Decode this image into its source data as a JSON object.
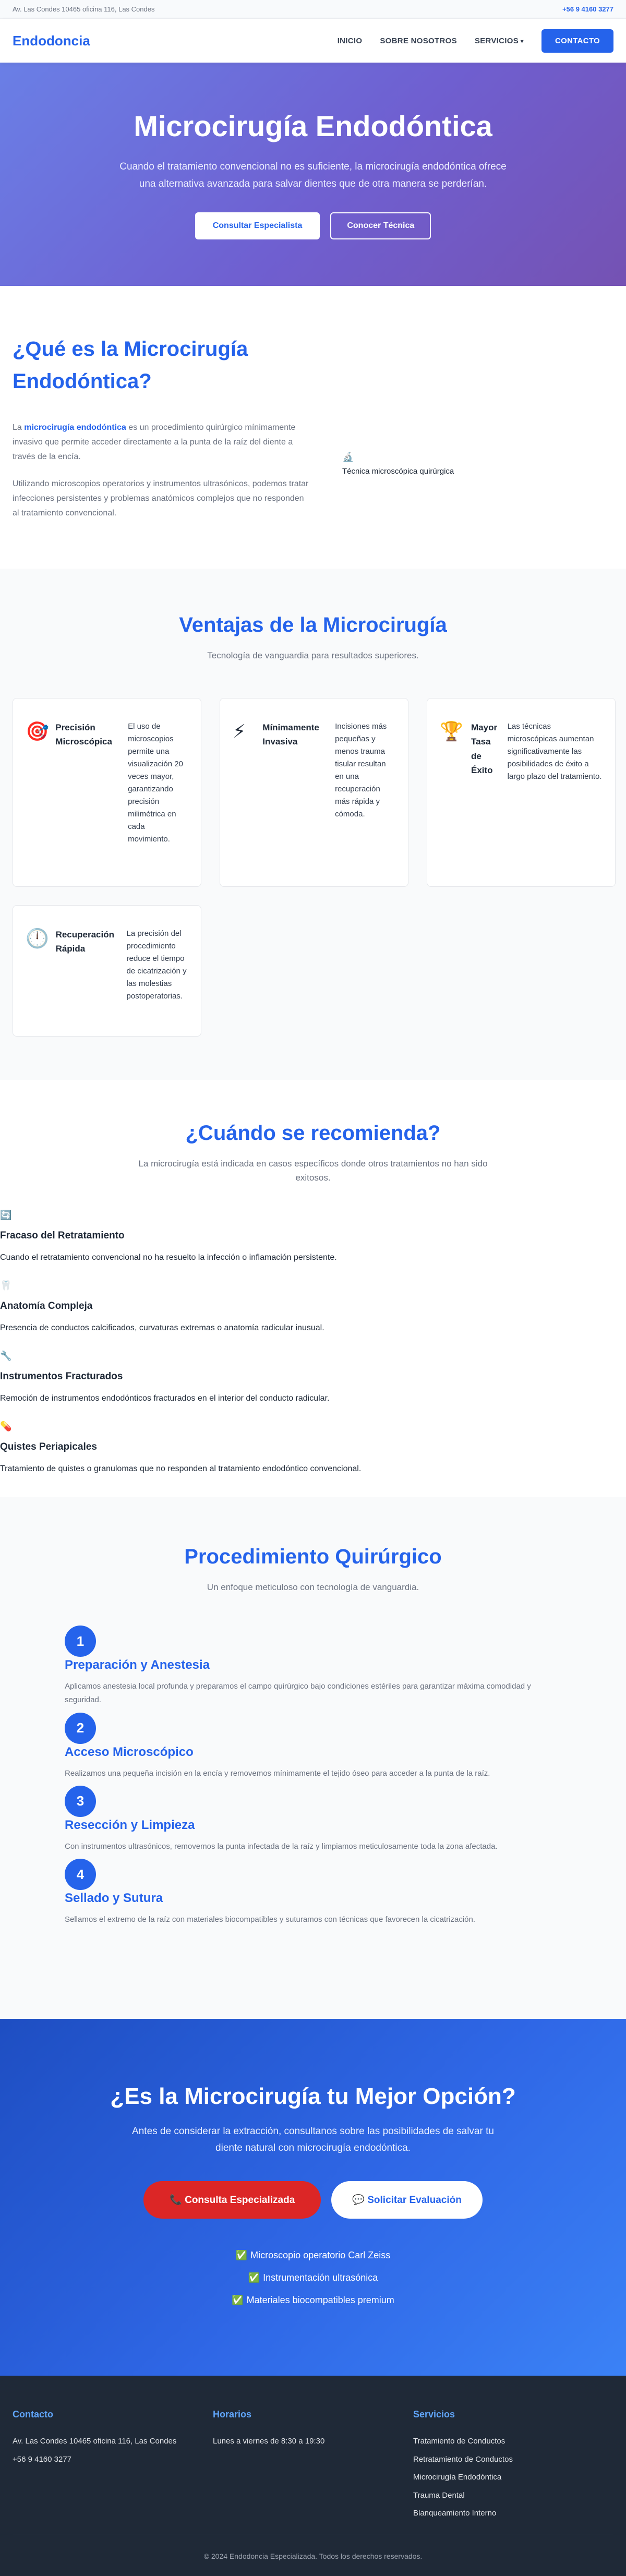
{
  "topbar": {
    "address": "Av. Las Condes 10465 oficina 116, Las Condes",
    "phone": "+56 9 4160 3277"
  },
  "header": {
    "logo": "Endodoncia",
    "nav": [
      "INICIO",
      "SOBRE NOSOTROS",
      "SERVICIOS"
    ],
    "contact_label": "CONTACTO"
  },
  "hero": {
    "title": "Microcirugía Endodóntica",
    "subtitle": "Cuando el tratamiento convencional no es suficiente, la microcirugía endodóntica ofrece una alternativa avanzada para salvar dientes que de otra manera se perderían.",
    "btn_primary": "Consultar Especialista",
    "btn_secondary": "Conocer Técnica"
  },
  "whatis": {
    "title": "¿Qué es la Microcirugía Endodóntica?",
    "p1_prefix": "La ",
    "p1_strong": "microcirugía endodóntica",
    "p1_rest": " es un procedimiento quirúrgico mínimamente invasivo que permite acceder directamente a la punta de la raíz del diente a través de la encía.",
    "p2": "Utilizando microscopios operatorios y instrumentos ultrasónicos, podemos tratar infecciones persistentes y problemas anatómicos complejos que no responden al tratamiento convencional.",
    "image_alt": "Técnica microscópica quirúrgica",
    "image_icon": "🔬"
  },
  "advantages": {
    "title": "Ventajas de la Microcirugía",
    "subtitle": "Tecnología de vanguardia para resultados superiores.",
    "cards": [
      {
        "icon": "🎯",
        "title": "Precisión Microscópica",
        "desc": "El uso de microscopios permite una visualización 20 veces mayor, garantizando precisión milimétrica en cada movimiento."
      },
      {
        "icon": "⚡",
        "title": "Mínimamente Invasiva",
        "desc": "Incisiones más pequeñas y menos trauma tisular resultan en una recuperación más rápida y cómoda."
      },
      {
        "icon": "🏆",
        "title": "Mayor Tasa de Éxito",
        "desc": "Las técnicas microscópicas aumentan significativamente las posibilidades de éxito a largo plazo del tratamiento."
      },
      {
        "icon": "🕛",
        "title": "Recuperación Rápida",
        "desc": "La precisión del procedimiento reduce el tiempo de cicatrización y las molestias postoperatorias."
      }
    ]
  },
  "when": {
    "title": "¿Cuándo se recomienda?",
    "subtitle": "La microcirugía está indicada en casos específicos donde otros tratamientos no han sido exitosos.",
    "items": [
      {
        "icon": "🔄",
        "title": "Fracaso del Retratamiento",
        "desc": "Cuando el retratamiento convencional no ha resuelto la infección o inflamación persistente."
      },
      {
        "icon": "🦷",
        "title": "Anatomía Compleja",
        "desc": "Presencia de conductos calcificados, curvaturas extremas o anatomía radicular inusual."
      },
      {
        "icon": "🔧",
        "title": "Instrumentos Fracturados",
        "desc": "Remoción de instrumentos endodónticos fracturados en el interior del conducto radicular."
      },
      {
        "icon": "💊",
        "title": "Quistes Periapicales",
        "desc": "Tratamiento de quistes o granulomas que no responden al tratamiento endodóntico convencional."
      }
    ]
  },
  "procedure": {
    "title": "Procedimiento Quirúrgico",
    "subtitle": "Un enfoque meticuloso con tecnología de vanguardia.",
    "steps": [
      {
        "num": "1",
        "title": "Preparación y Anestesia",
        "desc": "Aplicamos anestesia local profunda y preparamos el campo quirúrgico bajo condiciones estériles para garantizar máxima comodidad y seguridad."
      },
      {
        "num": "2",
        "title": "Acceso Microscópico",
        "desc": "Realizamos una pequeña incisión en la encía y removemos mínimamente el tejido óseo para acceder a la punta de la raíz."
      },
      {
        "num": "3",
        "title": "Resección y Limpieza",
        "desc": "Con instrumentos ultrasónicos, removemos la punta infectada de la raíz y limpiamos meticulosamente toda la zona afectada."
      },
      {
        "num": "4",
        "title": "Sellado y Sutura",
        "desc": "Sellamos el extremo de la raíz con materiales biocompatibles y suturamos con técnicas que favorecen la cicatrización."
      }
    ]
  },
  "cta": {
    "title": "¿Es la Microcirugía tu Mejor Opción?",
    "text": "Antes de considerar la extracción, consultanos sobre las posibilidades de salvar tu diente natural con microcirugía endodóntica.",
    "btn_primary": "Consulta Especializada",
    "btn_primary_icon": "📞",
    "btn_secondary": "Solicitar Evaluación",
    "btn_secondary_icon": "💬",
    "features": [
      "Microscopio operatorio Carl Zeiss",
      "Instrumentación ultrasónica",
      "Materiales biocompatibles premium"
    ],
    "check_icon": "✅"
  },
  "footer": {
    "contact_title": "Contacto",
    "address": "Av. Las Condes 10465 oficina 116, Las Condes",
    "phone": "+56 9 4160 3277",
    "hours_title": "Horarios",
    "hours": "Lunes a viernes de 8:30 a 19:30",
    "services_title": "Servicios",
    "services": [
      "Tratamiento de Conductos",
      "Retratamiento de Conductos",
      "Microcirugía Endodóntica",
      "Trauma Dental",
      "Blanqueamiento Interno"
    ],
    "copyright": "© 2024 Endodoncia Especializada. Todos los derechos reservados."
  },
  "colors": {
    "brand": "#2563eb",
    "hero_start": "#6a7fe6",
    "hero_end": "#7552b3",
    "cta_red": "#dc2626",
    "footer_bg": "#1f2937"
  }
}
